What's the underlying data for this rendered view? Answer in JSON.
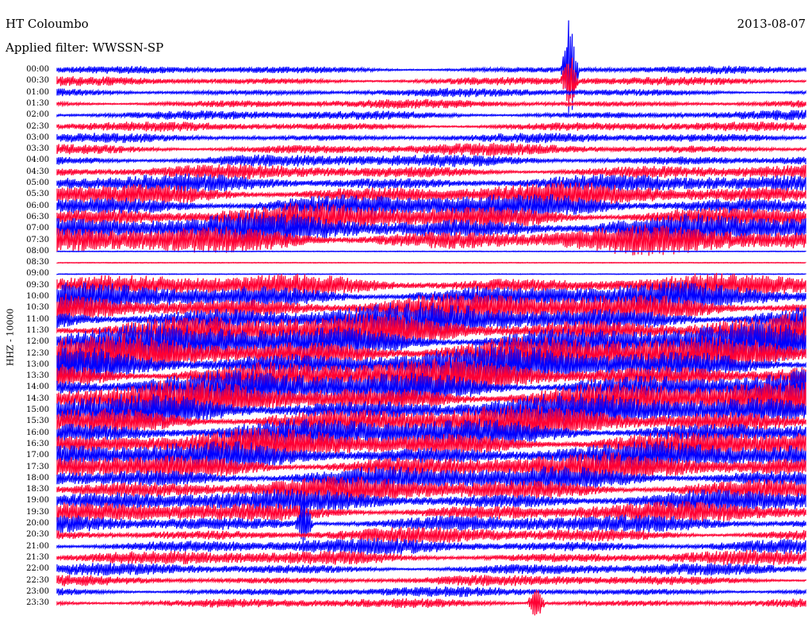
{
  "header": {
    "station": "HT Coloumbo",
    "filter": "Applied filter: WWSSN-SP",
    "date": "2013-08-07"
  },
  "chart_data": {
    "type": "helicorder",
    "station": "HT Coloumbo",
    "filter": "Applied filter: WWSSN-SP",
    "date": "2013-08-07",
    "ylabel": "HHZ - 10000",
    "row_labels": [
      "00:00",
      "00:30",
      "01:00",
      "01:30",
      "02:00",
      "02:30",
      "03:00",
      "03:30",
      "04:00",
      "04:30",
      "05:00",
      "05:30",
      "06:00",
      "06:30",
      "07:00",
      "07:30",
      "08:00",
      "08:30",
      "09:00",
      "09:30",
      "10:00",
      "10:30",
      "11:00",
      "11:30",
      "12:00",
      "12:30",
      "13:00",
      "13:30",
      "14:00",
      "14:30",
      "15:00",
      "15:30",
      "16:00",
      "16:30",
      "17:00",
      "17:30",
      "18:00",
      "18:30",
      "19:00",
      "19:30",
      "20:00",
      "20:30",
      "21:00",
      "21:30",
      "22:00",
      "22:30",
      "23:00",
      "23:30"
    ],
    "series_colors": [
      "#0000ff",
      "#ff0033"
    ],
    "row_noise_level": [
      0.35,
      0.45,
      0.4,
      0.45,
      0.5,
      0.5,
      0.5,
      0.7,
      0.8,
      0.9,
      1.2,
      1.6,
      1.8,
      2.0,
      2.2,
      2.0,
      0,
      0,
      0,
      1.6,
      2.0,
      2.2,
      2.4,
      2.6,
      2.8,
      2.8,
      2.8,
      2.6,
      2.6,
      2.6,
      2.4,
      2.4,
      2.2,
      2.2,
      2.0,
      2.0,
      1.8,
      1.8,
      1.6,
      1.4,
      1.2,
      1.0,
      1.0,
      0.9,
      0.7,
      0.6,
      0.5,
      0.5
    ],
    "events": [
      {
        "row": 0,
        "time_fraction": 0.685,
        "amplitude": 6.0
      },
      {
        "row": 1,
        "time_fraction": 0.685,
        "amplitude": 3.0
      },
      {
        "row": 40,
        "time_fraction": 0.33,
        "amplitude": 3.0
      },
      {
        "row": 47,
        "time_fraction": 0.64,
        "amplitude": 2.0
      }
    ]
  }
}
